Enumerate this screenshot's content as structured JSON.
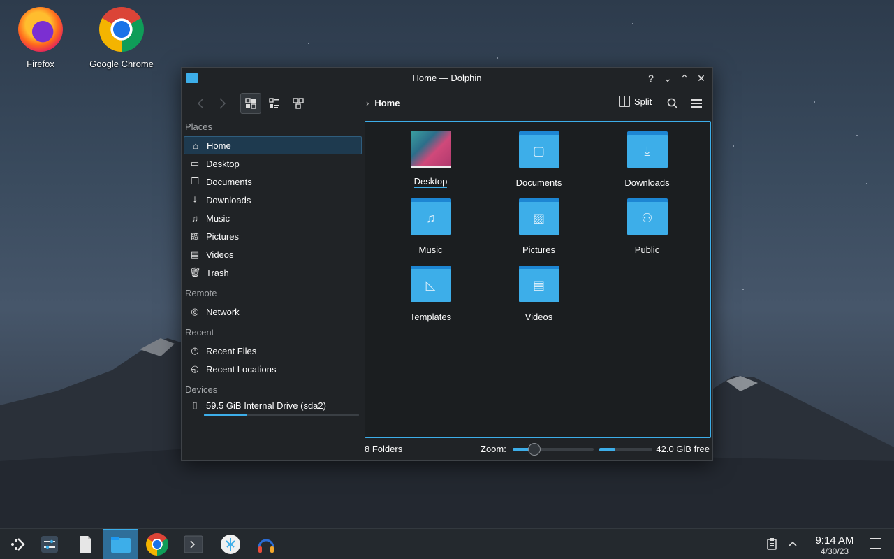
{
  "desktop": {
    "icons": [
      {
        "label": "Firefox",
        "icon": "firefox-icon"
      },
      {
        "label": "Google Chrome",
        "icon": "chrome-icon"
      }
    ]
  },
  "window": {
    "title": "Home — Dolphin",
    "controls": {
      "help": "?",
      "minimize": "⌄",
      "maximize": "⌃",
      "close": "✕"
    }
  },
  "toolbar": {
    "breadcrumb": "Home",
    "split_label": "Split"
  },
  "sidebar": {
    "sections": {
      "places": "Places",
      "remote": "Remote",
      "recent": "Recent",
      "devices": "Devices"
    },
    "places": [
      "Home",
      "Desktop",
      "Documents",
      "Downloads",
      "Music",
      "Pictures",
      "Videos",
      "Trash"
    ],
    "remote": [
      "Network"
    ],
    "recent": [
      "Recent Files",
      "Recent Locations"
    ],
    "devices": [
      {
        "label": "59.5 GiB Internal Drive (sda2)",
        "used_fraction": 0.28
      }
    ]
  },
  "main": {
    "items": [
      "Desktop",
      "Documents",
      "Downloads",
      "Music",
      "Pictures",
      "Public",
      "Templates",
      "Videos"
    ]
  },
  "status": {
    "count": "8 Folders",
    "zoom_label": "Zoom:",
    "zoom_fraction": 0.27,
    "free_fraction": 0.3,
    "free_label": "42.0 GiB free"
  },
  "taskbar": {
    "clock_time": "9:14 AM",
    "clock_date": "4/30/23"
  },
  "colors": {
    "accent": "#3daee9",
    "window_bg": "#202326",
    "view_bg": "#1b1e20"
  }
}
